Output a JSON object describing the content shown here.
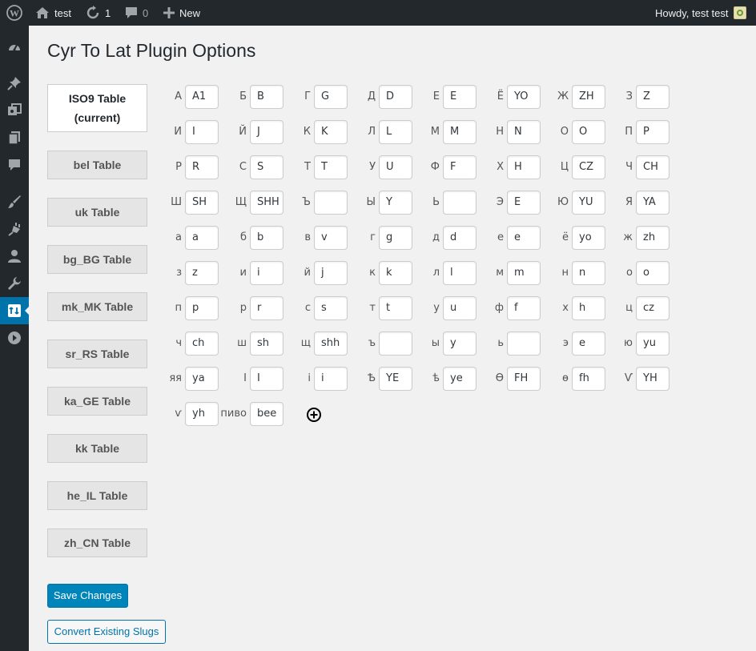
{
  "adminbar": {
    "site_name": "test",
    "updates_count": "1",
    "comments_count": "0",
    "new_label": "New",
    "greeting": "Howdy, test test"
  },
  "page": {
    "title": "Cyr To Lat Plugin Options"
  },
  "tabs": [
    "ISO9 Table\n(current)",
    "bel Table",
    "uk Table",
    "bg_BG Table",
    "mk_MK Table",
    "sr_RS Table",
    "ka_GE Table",
    "kk Table",
    "he_IL Table",
    "zh_CN Table"
  ],
  "table": [
    [
      "А",
      "A1"
    ],
    [
      "Б",
      "B"
    ],
    [
      "Г",
      "G"
    ],
    [
      "Д",
      "D"
    ],
    [
      "Е",
      "E"
    ],
    [
      "Ё",
      "YO"
    ],
    [
      "Ж",
      "ZH"
    ],
    [
      "З",
      "Z"
    ],
    [
      "И",
      "I"
    ],
    [
      "Й",
      "J"
    ],
    [
      "К",
      "K"
    ],
    [
      "Л",
      "L"
    ],
    [
      "М",
      "M"
    ],
    [
      "Н",
      "N"
    ],
    [
      "О",
      "O"
    ],
    [
      "П",
      "P"
    ],
    [
      "Р",
      "R"
    ],
    [
      "С",
      "S"
    ],
    [
      "Т",
      "T"
    ],
    [
      "У",
      "U"
    ],
    [
      "Ф",
      "F"
    ],
    [
      "Х",
      "H"
    ],
    [
      "Ц",
      "CZ"
    ],
    [
      "Ч",
      "CH"
    ],
    [
      "Ш",
      "SH"
    ],
    [
      "Щ",
      "SHH"
    ],
    [
      "Ъ",
      ""
    ],
    [
      "Ы",
      "Y"
    ],
    [
      "Ь",
      ""
    ],
    [
      "Э",
      "E"
    ],
    [
      "Ю",
      "YU"
    ],
    [
      "Я",
      "YA"
    ],
    [
      "а",
      "a"
    ],
    [
      "б",
      "b"
    ],
    [
      "в",
      "v"
    ],
    [
      "г",
      "g"
    ],
    [
      "д",
      "d"
    ],
    [
      "е",
      "e"
    ],
    [
      "ё",
      "yo"
    ],
    [
      "ж",
      "zh"
    ],
    [
      "з",
      "z"
    ],
    [
      "и",
      "i"
    ],
    [
      "й",
      "j"
    ],
    [
      "к",
      "k"
    ],
    [
      "л",
      "l"
    ],
    [
      "м",
      "m"
    ],
    [
      "н",
      "n"
    ],
    [
      "о",
      "o"
    ],
    [
      "п",
      "p"
    ],
    [
      "р",
      "r"
    ],
    [
      "с",
      "s"
    ],
    [
      "т",
      "t"
    ],
    [
      "у",
      "u"
    ],
    [
      "ф",
      "f"
    ],
    [
      "х",
      "h"
    ],
    [
      "ц",
      "cz"
    ],
    [
      "ч",
      "ch"
    ],
    [
      "ш",
      "sh"
    ],
    [
      "щ",
      "shh"
    ],
    [
      "ъ",
      ""
    ],
    [
      "ы",
      "y"
    ],
    [
      "ь",
      ""
    ],
    [
      "э",
      "e"
    ],
    [
      "ю",
      "yu"
    ],
    [
      "яя",
      "ya"
    ],
    [
      "І",
      "I"
    ],
    [
      "і",
      "i"
    ],
    [
      "Ѣ",
      "YE"
    ],
    [
      "ѣ",
      "ye"
    ],
    [
      "Ѳ",
      "FH"
    ],
    [
      "ѳ",
      "fh"
    ],
    [
      "Ѵ",
      "YH"
    ],
    [
      "ѵ",
      "yh"
    ],
    [
      "пиво",
      "bee"
    ]
  ],
  "buttons": {
    "save": "Save Changes",
    "convert": "Convert Existing Slugs"
  },
  "colors": {
    "adminbar_bg": "#23282d",
    "accent": "#0085ba",
    "page_bg": "#f1f1f1"
  }
}
